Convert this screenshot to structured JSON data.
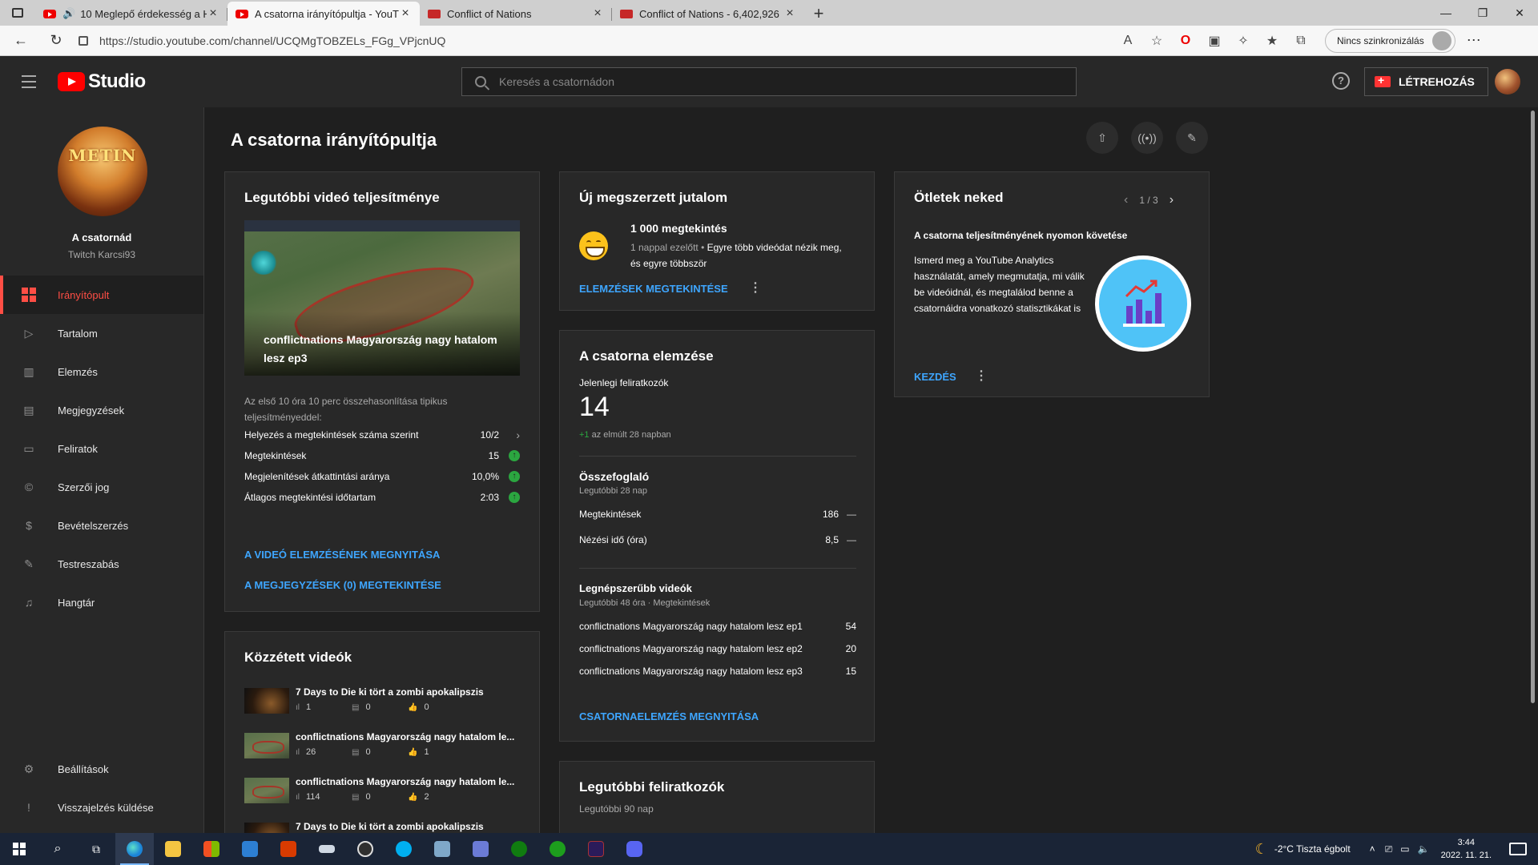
{
  "browser": {
    "tabs": [
      {
        "title": "10 Meglepő érdekesség a H",
        "audio": true
      },
      {
        "title": "A csatorna irányítópultja - YouTu",
        "active": true
      },
      {
        "title": "Conflict of Nations"
      },
      {
        "title": "Conflict of Nations - 6,402,926"
      }
    ],
    "url": "https://studio.youtube.com/channel/UCQMgTOBZELs_FGg_VPjcnUQ",
    "sync_label": "Nincs szinkronizálás"
  },
  "header": {
    "logo_text": "Studio",
    "search_placeholder": "Keresés a csatornádon",
    "help": "?",
    "create_label": "LÉTREHOZÁS"
  },
  "sidebar": {
    "avatar_text": "METIN",
    "channel_title": "A csatornád",
    "channel_name": "Twitch Karcsi93",
    "items": [
      {
        "label": "Irányítópult",
        "icon": "dashboard-icon",
        "active": true
      },
      {
        "label": "Tartalom",
        "icon": "content-icon"
      },
      {
        "label": "Elemzés",
        "icon": "analytics-icon"
      },
      {
        "label": "Megjegyzések",
        "icon": "comments-icon"
      },
      {
        "label": "Feliratok",
        "icon": "subtitles-icon"
      },
      {
        "label": "Szerzői jog",
        "icon": "copyright-icon"
      },
      {
        "label": "Bevételszerzés",
        "icon": "monetization-icon"
      },
      {
        "label": "Testreszabás",
        "icon": "customization-icon"
      },
      {
        "label": "Hangtár",
        "icon": "audio-library-icon"
      }
    ],
    "bottom": [
      {
        "label": "Beállítások",
        "icon": "settings-icon"
      },
      {
        "label": "Visszajelzés küldése",
        "icon": "feedback-icon"
      }
    ]
  },
  "main": {
    "title": "A csatorna irányítópultja",
    "latest_video": {
      "heading": "Legutóbbi videó teljesítménye",
      "video_title": "conflictnations Magyarország nagy hatalom lesz ep3",
      "compare_text": "Az első 10 óra 10 perc összehasonlítása tipikus teljesítményeddel:",
      "metrics": [
        {
          "label": "Helyezés a megtekintések száma szerint",
          "value": "10/2"
        },
        {
          "label": "Megtekintések",
          "value": "15"
        },
        {
          "label": "Megjelenítések átkattintási aránya",
          "value": "10,0%"
        },
        {
          "label": "Átlagos megtekintési időtartam",
          "value": "2:03"
        }
      ],
      "link_analytics": "A VIDEÓ ELEMZÉSÉNEK MEGNYITÁSA",
      "link_comments": "A MEGJEGYZÉSEK (0) MEGTEKINTÉSE"
    },
    "published": {
      "heading": "Közzétett videók",
      "videos": [
        {
          "title": "7 Days to Die ki tört a zombi apokalipszis",
          "views": "1",
          "comments": "0",
          "likes": "0"
        },
        {
          "title": "conflictnations Magyarország nagy hatalom le...",
          "views": "26",
          "comments": "0",
          "likes": "1"
        },
        {
          "title": "conflictnations Magyarország nagy hatalom le...",
          "views": "114",
          "comments": "0",
          "likes": "2"
        },
        {
          "title": "7 Days to Die ki tört a zombi apokalipszis",
          "views": "",
          "comments": "",
          "likes": ""
        }
      ]
    },
    "reward": {
      "heading": "Új megszerzett jutalom",
      "title": "1 000 megtekintés",
      "time": "1 nappal ezelőtt",
      "sep": " • ",
      "desc": "Egyre több videódat nézik meg, és egyre többször",
      "link": "ELEMZÉSEK MEGTEKINTÉSE"
    },
    "analytics": {
      "heading": "A csatorna elemzése",
      "subs_label": "Jelenlegi feliratkozók",
      "subs_value": "14",
      "subs_delta": "+1",
      "subs_delta_text": " az elmúlt 28 napban",
      "summary_heading": "Összefoglaló",
      "summary_period": "Legutóbbi 28 nap",
      "summary": [
        {
          "label": "Megtekintések",
          "value": "186",
          "trend": "—"
        },
        {
          "label": "Nézési idő (óra)",
          "value": "8,5",
          "trend": "—"
        }
      ],
      "top_heading": "Legnépszerűbb videók",
      "top_period": "Legutóbbi 48 óra · Megtekintések",
      "top": [
        {
          "title": "conflictnations Magyarország nagy hatalom lesz ep1",
          "value": "54"
        },
        {
          "title": "conflictnations Magyarország nagy hatalom lesz ep2",
          "value": "20"
        },
        {
          "title": "conflictnations Magyarország nagy hatalom lesz ep3",
          "value": "15"
        }
      ],
      "link": "CSATORNAELEMZÉS MEGNYITÁSA"
    },
    "recent_subs": {
      "heading": "Legutóbbi feliratkozók",
      "period": "Legutóbbi 90 nap"
    },
    "ideas": {
      "heading": "Ötletek neked",
      "pager": "1 / 3",
      "subtitle": "A csatorna teljesítményének nyomon követése",
      "text": "Ismerd meg a YouTube Analytics használatát, amely megmutatja, mi válik be videóidnál, és megtalálod benne a csatornáidra vonatkozó statisztikákat is",
      "link": "KEZDÉS"
    }
  },
  "taskbar": {
    "weather": "-2°C  Tiszta égbolt",
    "time": "3:44",
    "date": "2022. 11. 21."
  },
  "colors": {
    "accent_red": "#ff4e45",
    "link_blue": "#3ea6ff",
    "positive_green": "#2ba640"
  }
}
